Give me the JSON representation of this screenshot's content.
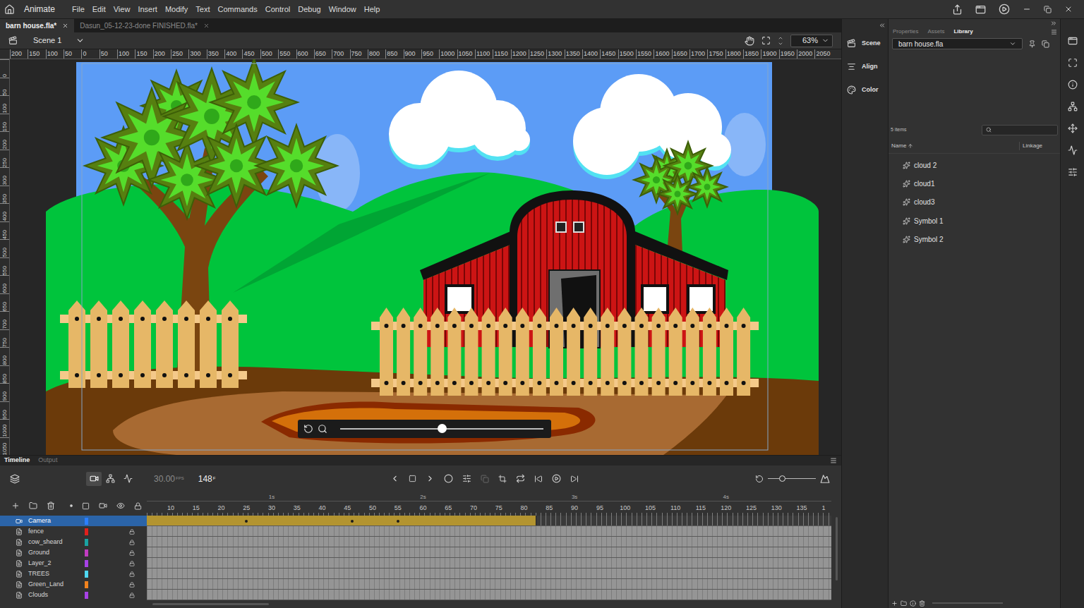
{
  "app": {
    "name": "Animate"
  },
  "menu": [
    "File",
    "Edit",
    "View",
    "Insert",
    "Modify",
    "Text",
    "Commands",
    "Control",
    "Debug",
    "Window",
    "Help"
  ],
  "documents": [
    {
      "label": "barn house.fla*",
      "selected": true
    },
    {
      "label": "Dasun_05-12-23-done FINISHED.fla*",
      "selected": false
    }
  ],
  "scene": {
    "label": "Scene 1",
    "zoom": "63%"
  },
  "rulers": {
    "horizontal": [
      "200",
      "150",
      "100",
      "50",
      "0",
      "50",
      "100",
      "150",
      "200",
      "250",
      "300",
      "350",
      "400",
      "450",
      "500",
      "550",
      "600",
      "650",
      "700",
      "750",
      "800",
      "850",
      "900",
      "950",
      "1000",
      "1050",
      "1100",
      "1150",
      "1200",
      "1250",
      "1300",
      "1350",
      "1400",
      "1450",
      "1500",
      "1550",
      "1600",
      "1650",
      "1700",
      "1750",
      "1800",
      "1850",
      "1900",
      "1950",
      "2000",
      "2050"
    ],
    "vertical": [
      "0",
      "50",
      "100",
      "150",
      "200",
      "250",
      "300",
      "350",
      "400",
      "450",
      "500",
      "550",
      "600",
      "650",
      "700",
      "750",
      "800",
      "850",
      "900",
      "950",
      "1000",
      "1050"
    ]
  },
  "camera_control": {
    "level": 0.5
  },
  "side_panels": [
    {
      "label": "Scene"
    },
    {
      "label": "Align"
    },
    {
      "label": "Color"
    }
  ],
  "library": {
    "tabs": [
      {
        "label": "Properties",
        "selected": false
      },
      {
        "label": "Assets",
        "selected": false
      },
      {
        "label": "Library",
        "selected": true
      }
    ],
    "document": "barn house.fla",
    "count": "5 items",
    "columns": [
      "Name",
      "Linkage"
    ],
    "items": [
      {
        "name": "cloud 2"
      },
      {
        "name": "cloud1"
      },
      {
        "name": "cloud3"
      },
      {
        "name": "Symbol 1"
      },
      {
        "name": "Symbol 2"
      }
    ]
  },
  "timeline": {
    "tabs": [
      {
        "label": "Timeline",
        "selected": true
      },
      {
        "label": "Output",
        "selected": false
      }
    ],
    "camera_tool_on": true,
    "fps": "30.00",
    "fps_unit": "FPS",
    "frame": "148",
    "frame_unit": "F",
    "frame_zoom_level": 0.3,
    "seconds": [
      {
        "label": "1s",
        "frame": 30
      },
      {
        "label": "2s",
        "frame": 60
      },
      {
        "label": "3s",
        "frame": 90
      },
      {
        "label": "4s",
        "frame": 120
      }
    ],
    "frame_ticks": [
      {
        "label": "10",
        "frame": 10
      },
      {
        "label": "15",
        "frame": 15
      },
      {
        "label": "20",
        "frame": 20
      },
      {
        "label": "25",
        "frame": 25
      },
      {
        "label": "30",
        "frame": 30
      },
      {
        "label": "35",
        "frame": 35
      },
      {
        "label": "40",
        "frame": 40
      },
      {
        "label": "45",
        "frame": 45
      },
      {
        "label": "50",
        "frame": 50
      },
      {
        "label": "55",
        "frame": 55
      },
      {
        "label": "60",
        "frame": 60
      },
      {
        "label": "65",
        "frame": 65
      },
      {
        "label": "70",
        "frame": 70
      },
      {
        "label": "75",
        "frame": 75
      },
      {
        "label": "80",
        "frame": 80
      },
      {
        "label": "85",
        "frame": 85
      },
      {
        "label": "90",
        "frame": 90
      },
      {
        "label": "95",
        "frame": 95
      },
      {
        "label": "100",
        "frame": 100
      },
      {
        "label": "105",
        "frame": 105
      },
      {
        "label": "110",
        "frame": 110
      },
      {
        "label": "115",
        "frame": 115
      },
      {
        "label": "120",
        "frame": 120
      },
      {
        "label": "125",
        "frame": 125
      },
      {
        "label": "130",
        "frame": 130
      },
      {
        "label": "135",
        "frame": 135
      },
      {
        "label": "1",
        "frame": 140
      }
    ],
    "layers": [
      {
        "name": "Camera",
        "kind": "camera",
        "selected": true,
        "locked": false,
        "color": "#2a7fff",
        "tween_end": 82,
        "keyframes": [
          25,
          46,
          55
        ]
      },
      {
        "name": "fence",
        "kind": "layer",
        "selected": false,
        "locked": true,
        "color": "#e0201c",
        "tween_end": 0,
        "keyframes": []
      },
      {
        "name": "cow_sheard",
        "kind": "layer",
        "selected": false,
        "locked": true,
        "color": "#1aa3a3",
        "tween_end": 0,
        "keyframes": []
      },
      {
        "name": "Ground",
        "kind": "layer",
        "selected": false,
        "locked": true,
        "color": "#c13cc1",
        "tween_end": 0,
        "keyframes": []
      },
      {
        "name": "Layer_2",
        "kind": "layer",
        "selected": false,
        "locked": true,
        "color": "#a842e6",
        "tween_end": 0,
        "keyframes": []
      },
      {
        "name": "TREES",
        "kind": "layer",
        "selected": false,
        "locked": true,
        "color": "#4fd8f2",
        "tween_end": 0,
        "keyframes": []
      },
      {
        "name": "Green_Land",
        "kind": "layer",
        "selected": false,
        "locked": true,
        "color": "#f0821e",
        "tween_end": 0,
        "keyframes": []
      },
      {
        "name": "Clouds",
        "kind": "layer",
        "selected": false,
        "locked": true,
        "color": "#a842e6",
        "tween_end": 0,
        "keyframes": []
      }
    ]
  }
}
